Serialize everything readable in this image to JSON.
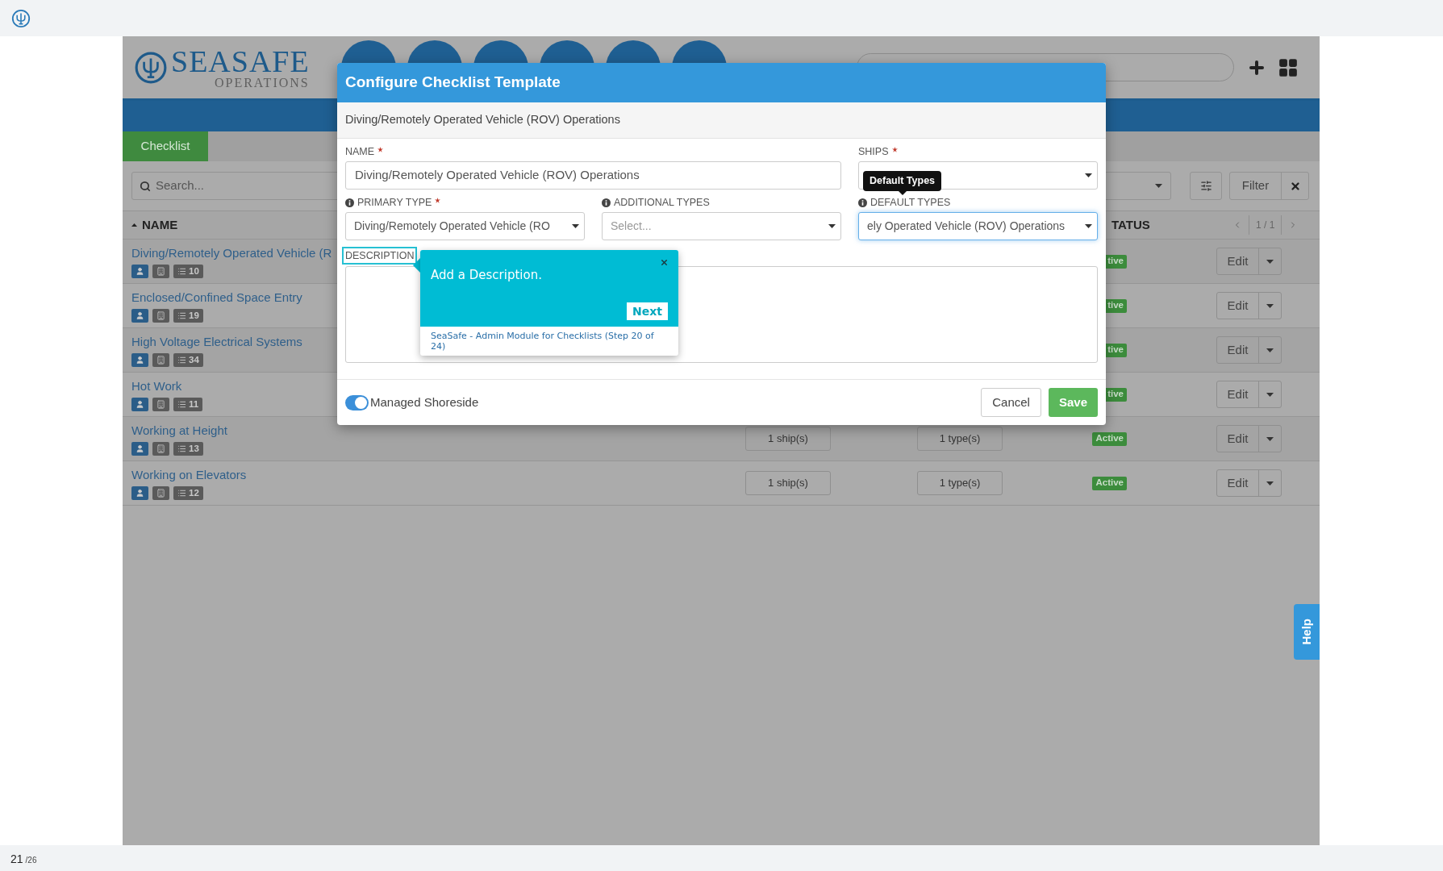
{
  "app": {
    "logo": {
      "title": "SEASAFE",
      "subtitle": "OPERATIONS"
    },
    "tabs": [
      {
        "label": "Checklist",
        "selected": true
      }
    ],
    "search": {
      "placeholder": "Search..."
    },
    "filter_button": "Filter",
    "columns": [
      {
        "label": "NAME",
        "sorted": true
      },
      {
        "label": "TATUS",
        "sorted": false
      }
    ],
    "pagination": "1 / 1",
    "rows": [
      {
        "name": "Diving/Remotely Operated Vehicle (R",
        "count": "10",
        "status": "tive",
        "action": "Edit"
      },
      {
        "name": "Enclosed/Confined Space Entry",
        "count": "19",
        "status": "tive",
        "action": "Edit"
      },
      {
        "name": "High Voltage Electrical Systems",
        "count": "34",
        "status": "tive",
        "action": "Edit"
      },
      {
        "name": "Hot Work",
        "count": "11",
        "status": "tive",
        "action": "Edit"
      },
      {
        "name": "Working at Height",
        "count": "13",
        "ships": "1 ship(s)",
        "types": "1 type(s)",
        "status": "Active",
        "action": "Edit"
      },
      {
        "name": "Working on Elevators",
        "count": "12",
        "ships": "1 ship(s)",
        "types": "1 type(s)",
        "status": "Active",
        "action": "Edit"
      }
    ]
  },
  "modal": {
    "title": "Configure Checklist Template",
    "subtitle": "Diving/Remotely Operated Vehicle (ROV) Operations",
    "fields": [
      {
        "kind": "text",
        "label": "NAME",
        "required": true,
        "info": false,
        "value": "Diving/Remotely Operated Vehicle (ROV) Operations",
        "focused": false
      },
      {
        "kind": "select",
        "label": "SHIPS",
        "required": true,
        "info": false,
        "focused": false
      },
      {
        "kind": "select",
        "label": "PRIMARY TYPE",
        "required": true,
        "info": true,
        "value": "Diving/Remotely Operated Vehicle (RO",
        "focused": false
      },
      {
        "kind": "select",
        "label": "ADDITIONAL TYPES",
        "required": false,
        "info": true,
        "placeholder": "Select...",
        "focused": false
      },
      {
        "kind": "select",
        "label": "DEFAULT TYPES",
        "required": false,
        "info": true,
        "value": "ely Operated Vehicle (ROV) Operations",
        "focused": true
      }
    ],
    "description_label": "DESCRIPTION",
    "managed_shoreside": {
      "label": "Managed Shoreside",
      "on": true
    },
    "cancel": "Cancel",
    "save": "Save"
  },
  "tooltip": "Default Types",
  "tour": {
    "text": "Add a Description.",
    "next": "Next",
    "footer": "SeaSafe - Admin Module for Checklists (Step 20 of 24)"
  },
  "help_tab": "Help",
  "slide_counter": {
    "current": "21",
    "total": "/26"
  }
}
